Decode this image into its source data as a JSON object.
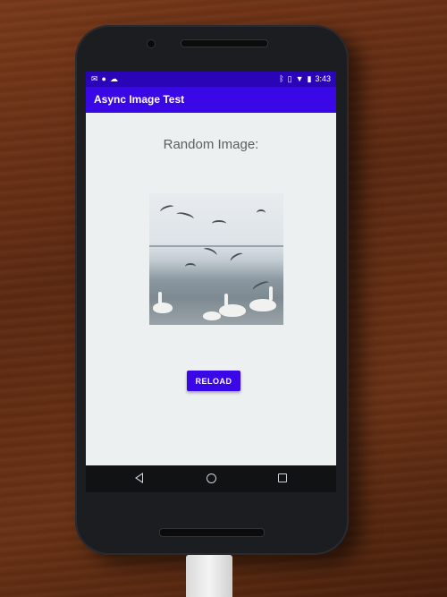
{
  "status_bar": {
    "time": "3:43",
    "left_icons": [
      "gmail-icon",
      "app-notification-icon",
      "cloud-icon"
    ],
    "right_icons": [
      "bluetooth-icon",
      "vibrate-icon",
      "wifi-icon",
      "battery-icon"
    ]
  },
  "app_bar": {
    "title": "Async Image Test"
  },
  "content": {
    "heading": "Random Image:",
    "reload_label": "RELOAD",
    "image_subject": "seagulls and swans over water"
  },
  "nav_bar": {
    "buttons": [
      "back",
      "home",
      "recents"
    ]
  },
  "colors": {
    "status_bar": "#2a05b8",
    "app_bar": "#3a08e6",
    "button": "#3a08e6",
    "screen_bg": "#ecf0f0",
    "heading_text": "#5b5f60"
  }
}
